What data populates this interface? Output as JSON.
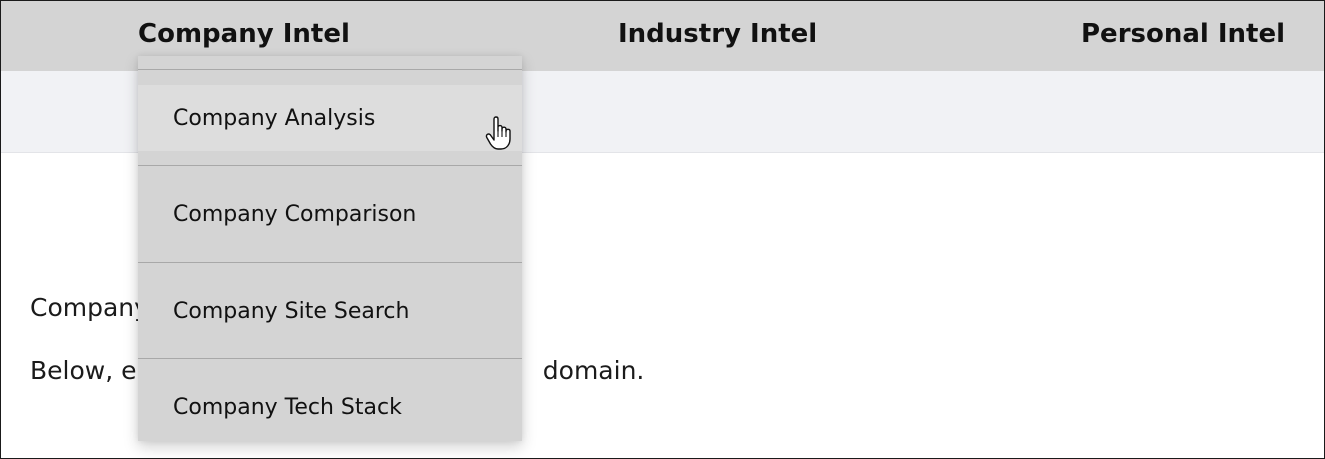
{
  "nav": {
    "items": [
      {
        "label": "Company Intel"
      },
      {
        "label": "Industry Intel"
      },
      {
        "label": "Personal Intel"
      }
    ]
  },
  "content": {
    "line1": "Company",
    "line2_start": "Below, er",
    "line2_end": "domain."
  },
  "dropdown": {
    "items": [
      {
        "label": "Company Analysis",
        "state": "hover"
      },
      {
        "label": "Company Comparison"
      },
      {
        "label": "Company Site Search"
      },
      {
        "label": "Company Tech Stack"
      }
    ]
  },
  "colors": {
    "nav_bg": "#d4d4d4",
    "subbar_bg": "#f1f2f5",
    "dropdown_bg": "#d4d4d4",
    "dropdown_hover_bg": "#dddddd"
  },
  "icons": {
    "cursor": "hand-pointer-icon"
  }
}
